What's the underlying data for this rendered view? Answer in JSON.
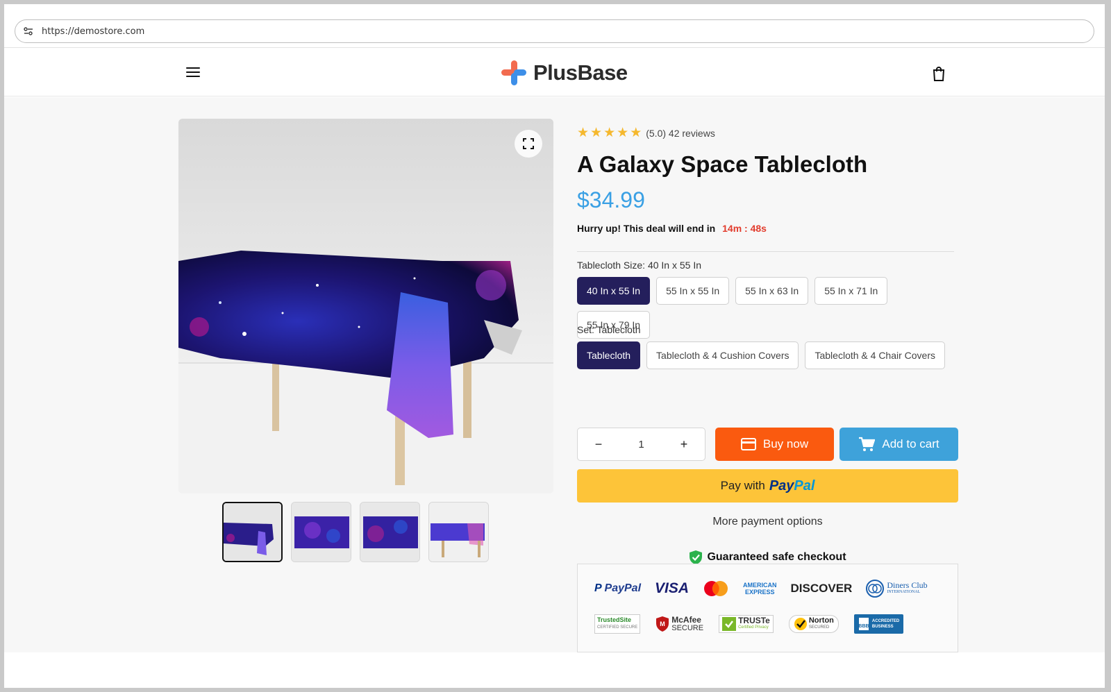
{
  "browser": {
    "url": "https://demostore.com"
  },
  "store": {
    "brand": "PlusBase"
  },
  "product": {
    "rating_text": "(5.0) 42 reviews",
    "title": "A Galaxy Space Tablecloth",
    "price": "$34.99",
    "hurry_text": "Hurry up! This deal will end in",
    "timer": "14m : 48s",
    "size_label": "Tablecloth Size: 40 In x 55 In",
    "sizes": [
      "40 In x 55 In",
      "55 In x 55 In",
      "55 In x 63 In",
      "55 In x 71 In",
      "55 In x 79 In"
    ],
    "set_label": "Set: Tablecloth",
    "sets": [
      "Tablecloth",
      "Tablecloth & 4 Cushion Covers",
      "Tablecloth & 4 Chair Covers"
    ],
    "quantity": "1",
    "qty_minus": "−",
    "qty_plus": "+",
    "buy_now": "Buy now",
    "add_to_cart": "Add to cart",
    "paypal_prefix": "Pay with",
    "paypal_pay": "Pay",
    "paypal_pal": "Pal",
    "more_payment": "More payment options",
    "safe_checkout": "Guaranteed safe checkout"
  },
  "payment_logos": {
    "paypal": "PayPal",
    "visa": "VISA",
    "amex_1": "AMERICAN",
    "amex_2": "EXPRESS",
    "discover": "DISCOVER",
    "diners_1": "Diners Club",
    "diners_2": "INTERNATIONAL"
  },
  "trust_badges": {
    "trustedsite_1": "TrustedSite",
    "trustedsite_2": "CERTIFIED SECURE",
    "mcafee_1": "McAfee",
    "mcafee_2": "SECURE",
    "truste_1": "TRUSTe",
    "truste_2": "Certified Privacy",
    "norton_1": "Norton",
    "norton_2": "SECURED",
    "bbb_1": "ACCREDITED",
    "bbb_2": "BUSINESS"
  },
  "colors": {
    "accent_selected": "#241f5c",
    "price": "#3aa0e4",
    "buy_now": "#fa5a0f",
    "add_to_cart": "#3ea2da",
    "paypal_button": "#fdc439",
    "timer": "#e23c2d",
    "star": "#f5b82e"
  }
}
